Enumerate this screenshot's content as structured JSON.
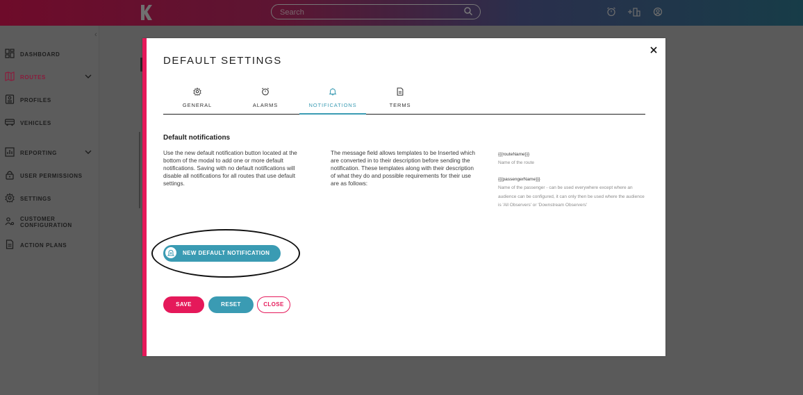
{
  "header": {
    "search_placeholder": "Search",
    "icons": [
      "logo-k",
      "search-icon",
      "alarm-clock-icon",
      "add-building-icon",
      "account-icon"
    ]
  },
  "sidebar": {
    "items": [
      {
        "label": "DASHBOARD",
        "icon": "dashboard-icon"
      },
      {
        "label": "ROUTES",
        "icon": "map-icon",
        "active": true,
        "expandable": true
      },
      {
        "label": "PROFILES",
        "icon": "profile-icon"
      },
      {
        "label": "VEHICLES",
        "icon": "bus-icon"
      },
      {
        "label": "REPORTING",
        "icon": "report-icon",
        "expandable": true
      },
      {
        "label": "USER PERMISSIONS",
        "icon": "lock-icon"
      },
      {
        "label": "SETTINGS",
        "icon": "gear-icon"
      },
      {
        "label": "CUSTOMER CONFIGURATION",
        "icon": "users-config-icon"
      },
      {
        "label": "ACTION PLANS",
        "icon": "document-icon"
      }
    ]
  },
  "modal": {
    "title": "DEFAULT SETTINGS",
    "tabs": [
      {
        "label": "GENERAL",
        "icon": "gear-icon"
      },
      {
        "label": "ALARMS",
        "icon": "alarm-clock-icon"
      },
      {
        "label": "NOTIFICATIONS",
        "icon": "bell-icon",
        "active": true
      },
      {
        "label": "TERMS",
        "icon": "document-icon"
      }
    ],
    "section_title": "Default notifications",
    "desc_left": "Use the new default notification button located at the bottom of the modal to add one or more default notifications. Saving with no default notifications will disable all notifications for all routes that use default settings.",
    "desc_middle": "The message field allows templates to be Inserted which are converted in to their description before sending the notification. These templates along with their description of what they do and possible requirements for their use are as follows:",
    "templates": [
      {
        "name": "{{{routeName}}}",
        "description": "Name of the route"
      },
      {
        "name": "{{{passengerName}}}",
        "description": "Name of the passenger - can be used everywhere except where an audience can be configured, it can only then be used where the audience is 'All Observers' or 'Downstream Observers'"
      }
    ],
    "new_button_label": "NEW DEFAULT NOTIFICATION",
    "buttons": {
      "save": "SAVE",
      "reset": "RESET",
      "close": "CLOSE"
    }
  },
  "colors": {
    "accent_pink": "#e5195a",
    "accent_teal": "#3a9bb3"
  }
}
